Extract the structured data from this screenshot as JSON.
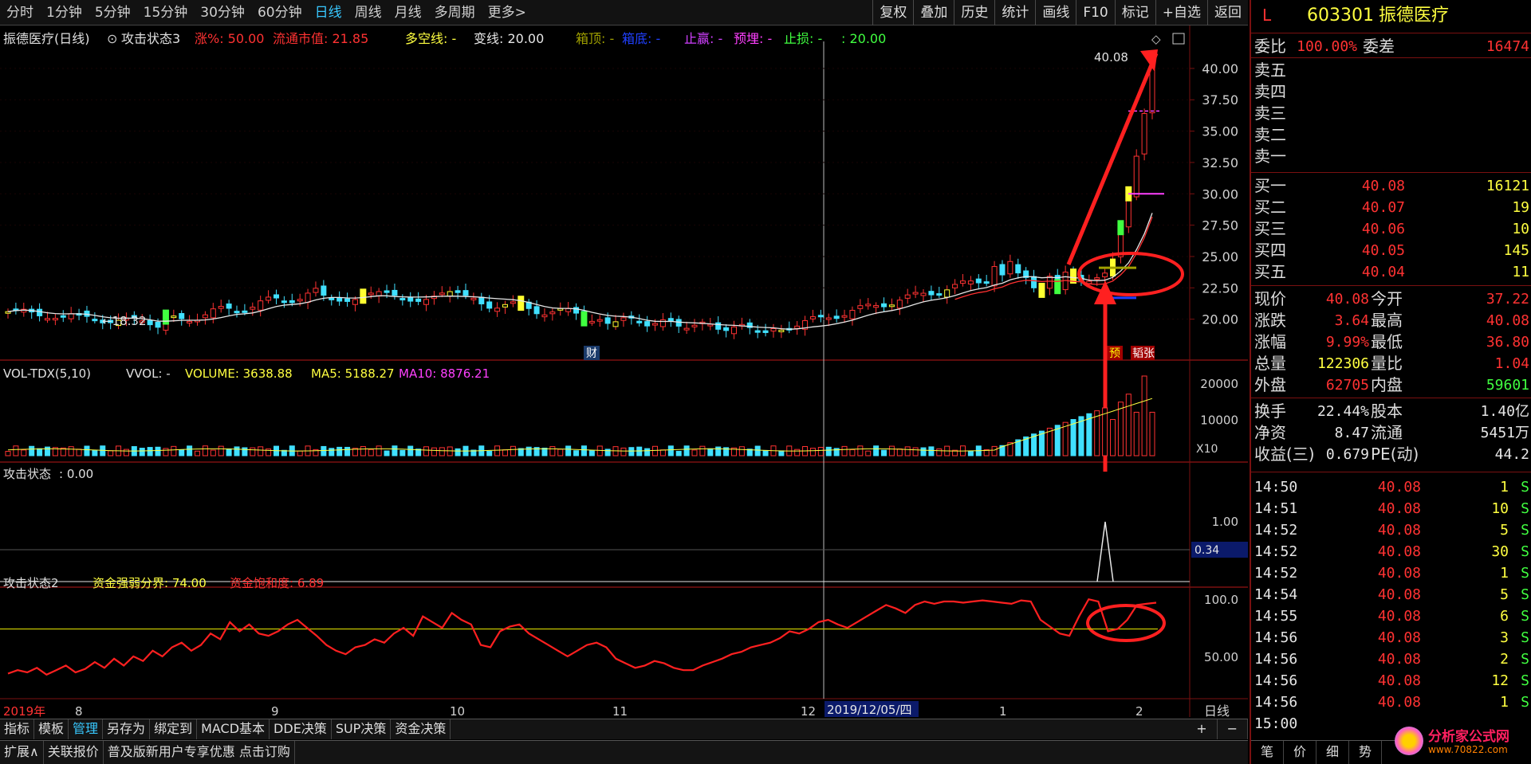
{
  "toolbar": {
    "periods": [
      "分时",
      "1分钟",
      "5分钟",
      "15分钟",
      "30分钟",
      "60分钟",
      "日线",
      "周线",
      "月线",
      "多周期",
      "更多>"
    ],
    "active_period": "日线",
    "right_tools": [
      "复权",
      "叠加",
      "历史",
      "统计",
      "画线",
      "F10",
      "标记",
      "+自选",
      "返回"
    ]
  },
  "main_panel": {
    "title": "振德医疗(日线)",
    "indicator": "攻击状态3",
    "items": [
      {
        "label": "涨%:",
        "value": "50.00",
        "color": "#ff3232"
      },
      {
        "label": "流通市值:",
        "value": "21.85",
        "color": "#ff3232"
      },
      {
        "label": "多空线:",
        "value": "-",
        "color": "#ffff40"
      },
      {
        "label": "变线:",
        "value": "20.00",
        "color": "#e6e6e6"
      },
      {
        "label": "箱顶:",
        "value": "-",
        "color": "#a0a000"
      },
      {
        "label": "箱底:",
        "value": "-",
        "color": "#2040ff"
      },
      {
        "label": "止赢:",
        "value": "-",
        "color": "#d040ff"
      },
      {
        "label": "预埋:",
        "value": "-",
        "color": "#ff40ff"
      },
      {
        "label": "止损:",
        "value": "-",
        "color": "#40ff40"
      },
      {
        "label": ":",
        "value": "20.00",
        "color": "#40ff40"
      }
    ],
    "y_labels": [
      "40.00",
      "37.50",
      "35.00",
      "32.50",
      "30.00",
      "27.50",
      "25.00",
      "22.50",
      "20.00"
    ],
    "high_label": "40.08",
    "low_label": "18.32",
    "tag_cai": "财",
    "tag_yu": "预",
    "tag_zhang": "韬张"
  },
  "vol_panel": {
    "title": "VOL-TDX(5,10)",
    "vvol": "VVOL: -",
    "volume": "VOLUME: 3638.88",
    "ma5": "MA5: 5188.27",
    "ma10": "MA10: 8876.21",
    "y_labels": [
      "20000",
      "10000"
    ],
    "unit": "X10"
  },
  "attack_panel": {
    "title": "攻击状态",
    "value": ": 0.00",
    "y_label": "1.00",
    "marker": "0.34"
  },
  "attack2_panel": {
    "title": "攻击状态2",
    "strong_weak": "资金强弱分界: 74.00",
    "saturation": "资金饱和度: 6.89",
    "y_labels": [
      "100.0",
      "50.00"
    ]
  },
  "x_axis": {
    "labels": [
      "2019年",
      "8",
      "9",
      "10",
      "11",
      "12",
      "1",
      "2"
    ],
    "cursor_date": "2019/12/05/四",
    "period_label": "日线"
  },
  "bottom_tabs1": [
    "指标",
    "模板",
    "管理",
    "另存为",
    "绑定到",
    "MACD基本",
    "DDE决策",
    "SUP决策",
    "资金决策"
  ],
  "bottom_tabs1_active": "管理",
  "bottom_tabs2": [
    "扩展∧",
    "关联报价",
    "普及版新用户专享优惠 点击订购"
  ],
  "bottom_right_btns": [
    "+",
    "−"
  ],
  "quote": {
    "code": "603301",
    "name": "振德医疗",
    "flag": "L",
    "weibi_label": "委比",
    "weibi": "100.00%",
    "weicha_label": "委差",
    "weicha": "16474",
    "sell": [
      {
        "label": "卖五"
      },
      {
        "label": "卖四"
      },
      {
        "label": "卖三"
      },
      {
        "label": "卖二"
      },
      {
        "label": "卖一"
      }
    ],
    "buy": [
      {
        "label": "买一",
        "price": "40.08",
        "vol": "16121"
      },
      {
        "label": "买二",
        "price": "40.07",
        "vol": "19"
      },
      {
        "label": "买三",
        "price": "40.06",
        "vol": "10"
      },
      {
        "label": "买四",
        "price": "40.05",
        "vol": "145"
      },
      {
        "label": "买五",
        "price": "40.04",
        "vol": "11"
      }
    ],
    "stats": [
      {
        "l1": "现价",
        "v1": "40.08",
        "c1": "#ff3232",
        "l2": "今开",
        "v2": "37.22",
        "c2": "#ff3232"
      },
      {
        "l1": "涨跌",
        "v1": "3.64",
        "c1": "#ff3232",
        "l2": "最高",
        "v2": "40.08",
        "c2": "#ff3232"
      },
      {
        "l1": "涨幅",
        "v1": "9.99%",
        "c1": "#ff3232",
        "l2": "最低",
        "v2": "36.80",
        "c2": "#ff3232"
      },
      {
        "l1": "总量",
        "v1": "122306",
        "c1": "#ffff40",
        "l2": "量比",
        "v2": "1.04",
        "c2": "#ff3232"
      },
      {
        "l1": "外盘",
        "v1": "62705",
        "c1": "#ff3232",
        "l2": "内盘",
        "v2": "59601",
        "c2": "#40ff40"
      },
      {
        "l1": "换手",
        "v1": "22.44%",
        "c1": "#e6e6e6",
        "l2": "股本",
        "v2": "1.40亿",
        "c2": "#e6e6e6"
      },
      {
        "l1": "净资",
        "v1": "8.47",
        "c1": "#e6e6e6",
        "l2": "流通",
        "v2": "5451万",
        "c2": "#e6e6e6"
      },
      {
        "l1": "收益(三)",
        "v1": "0.679",
        "c1": "#e6e6e6",
        "l2": "PE(动)",
        "v2": "44.2",
        "c2": "#e6e6e6"
      }
    ],
    "ticks": [
      {
        "time": "14:50",
        "price": "40.08",
        "vol": "1",
        "dir": "S"
      },
      {
        "time": "14:51",
        "price": "40.08",
        "vol": "10",
        "dir": "S"
      },
      {
        "time": "14:52",
        "price": "40.08",
        "vol": "5",
        "dir": "S"
      },
      {
        "time": "14:52",
        "price": "40.08",
        "vol": "30",
        "dir": "S"
      },
      {
        "time": "14:52",
        "price": "40.08",
        "vol": "1",
        "dir": "S"
      },
      {
        "time": "14:54",
        "price": "40.08",
        "vol": "5",
        "dir": "S"
      },
      {
        "time": "14:55",
        "price": "40.08",
        "vol": "6",
        "dir": "S"
      },
      {
        "time": "14:56",
        "price": "40.08",
        "vol": "3",
        "dir": "S"
      },
      {
        "time": "14:56",
        "price": "40.08",
        "vol": "2",
        "dir": "S"
      },
      {
        "time": "14:56",
        "price": "40.08",
        "vol": "12",
        "dir": "S"
      },
      {
        "time": "14:56",
        "price": "40.08",
        "vol": "1",
        "dir": "S"
      },
      {
        "time": "15:00",
        "price": "",
        "vol": "",
        "dir": ""
      }
    ],
    "bottom_tabs": [
      "笔",
      "价",
      "细",
      "势"
    ]
  },
  "logo": {
    "name": "分析家公式网",
    "url": "www.70822.com"
  },
  "colors": {
    "up": "#ff3232",
    "down": "#40e0ff",
    "ma": "#ffffff",
    "accent": "#38c8ff",
    "border": "#7a1010",
    "annotation": "#ff2020"
  }
}
